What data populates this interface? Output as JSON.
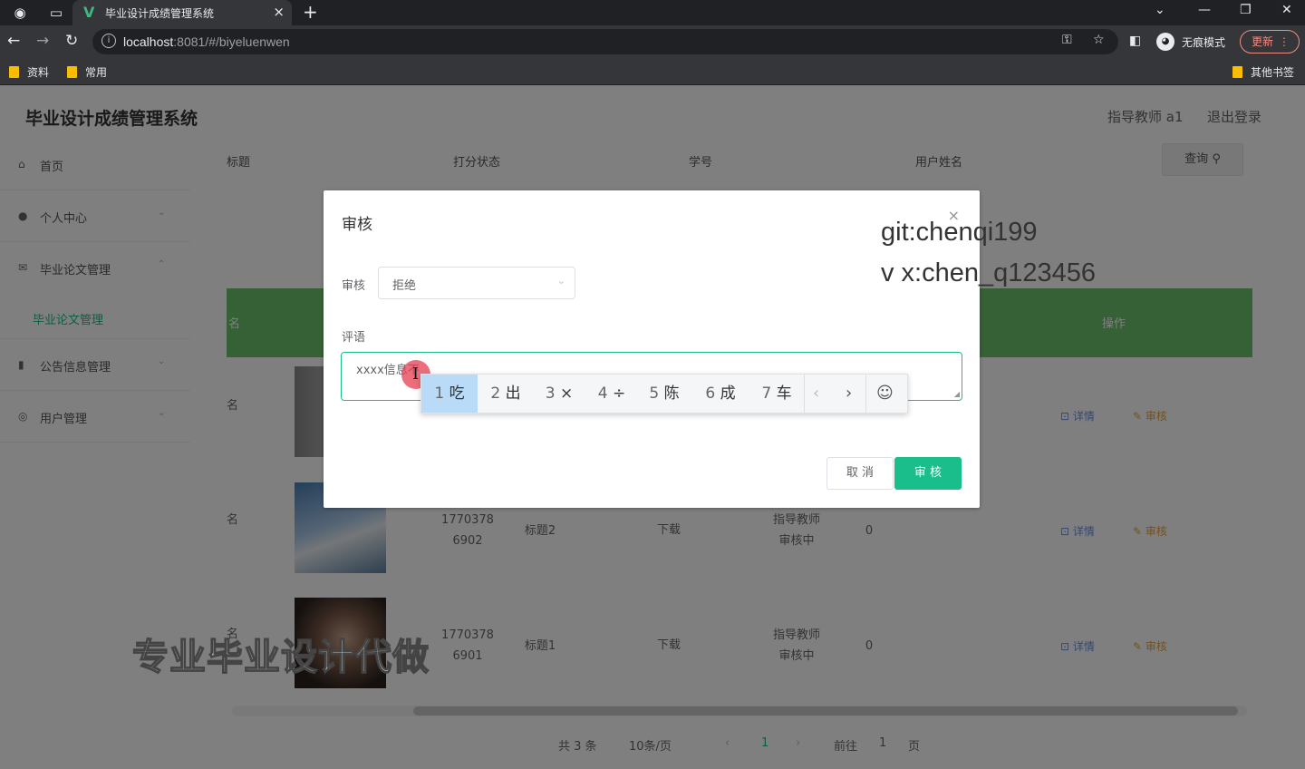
{
  "browser": {
    "tab_title": "毕业设计成绩管理系统",
    "tab_favicon": "V",
    "url_host": "localhost",
    "url_rest": ":8081/#/biyeluenwen",
    "profile_label": "无痕模式",
    "update_label": "更新",
    "bookmarks": [
      {
        "label": "资料"
      },
      {
        "label": "常用"
      }
    ],
    "other_bookmarks": "其他书签"
  },
  "app": {
    "title": "毕业设计成绩管理系统",
    "user_label": "指导教师 a1",
    "logout_label": "退出登录"
  },
  "sidebar": {
    "items": [
      {
        "label": "首页",
        "icon": "home-icon"
      },
      {
        "label": "个人中心",
        "icon": "user-icon"
      },
      {
        "label": "毕业论文管理",
        "icon": "mail-icon"
      },
      {
        "label": "公告信息管理",
        "icon": "chart-icon"
      },
      {
        "label": "用户管理",
        "icon": "compass-icon"
      }
    ],
    "sub_item": "毕业论文管理"
  },
  "search": {
    "labels": [
      "标题",
      "打分状态",
      "学号",
      "用户姓名"
    ],
    "button": "查询"
  },
  "table": {
    "header_action": "操作",
    "header_first": "名",
    "rows": [
      {
        "col1": "名",
        "student_id": "",
        "title": "",
        "file": "",
        "status": "",
        "score": "",
        "detail": "详情",
        "review": "审核"
      },
      {
        "col1": "名",
        "student_id": "1770378\n6902",
        "title": "标题2",
        "file": "下载",
        "status": "指导教师\n审核中",
        "score": "0",
        "detail": "详情",
        "review": "审核"
      },
      {
        "col1": "名",
        "student_id": "1770378\n6901",
        "title": "标题1",
        "file": "下载",
        "status": "指导教师\n审核中",
        "score": "0",
        "detail": "详情",
        "review": "审核"
      }
    ]
  },
  "pagination": {
    "total": "共 3 条",
    "page_size": "10条/页",
    "current": "1",
    "goto_label": "前往",
    "goto_value": "1",
    "page_suffix": "页"
  },
  "dialog": {
    "title": "审核",
    "field_review_label": "审核",
    "field_review_value": "拒绝",
    "field_comment_label": "评语",
    "comment_value": "xxxx信息不",
    "cancel_label": "取 消",
    "confirm_label": "审 核"
  },
  "ime": {
    "candidates": [
      {
        "num": "1",
        "char": "吃"
      },
      {
        "num": "2",
        "char": "出"
      },
      {
        "num": "3",
        "char": "×"
      },
      {
        "num": "4",
        "char": "÷"
      },
      {
        "num": "5",
        "char": "陈"
      },
      {
        "num": "6",
        "char": "成"
      },
      {
        "num": "7",
        "char": "车"
      }
    ]
  },
  "watermark": {
    "line1": "git:chenqi199",
    "line2": "v x:chen_q123456"
  },
  "promo_text": "专业毕业设计代做",
  "colors": {
    "accent": "#19be8b",
    "table_header": "#6cc26c",
    "chrome_dark": "#202124",
    "chrome_mid": "#35363a"
  }
}
